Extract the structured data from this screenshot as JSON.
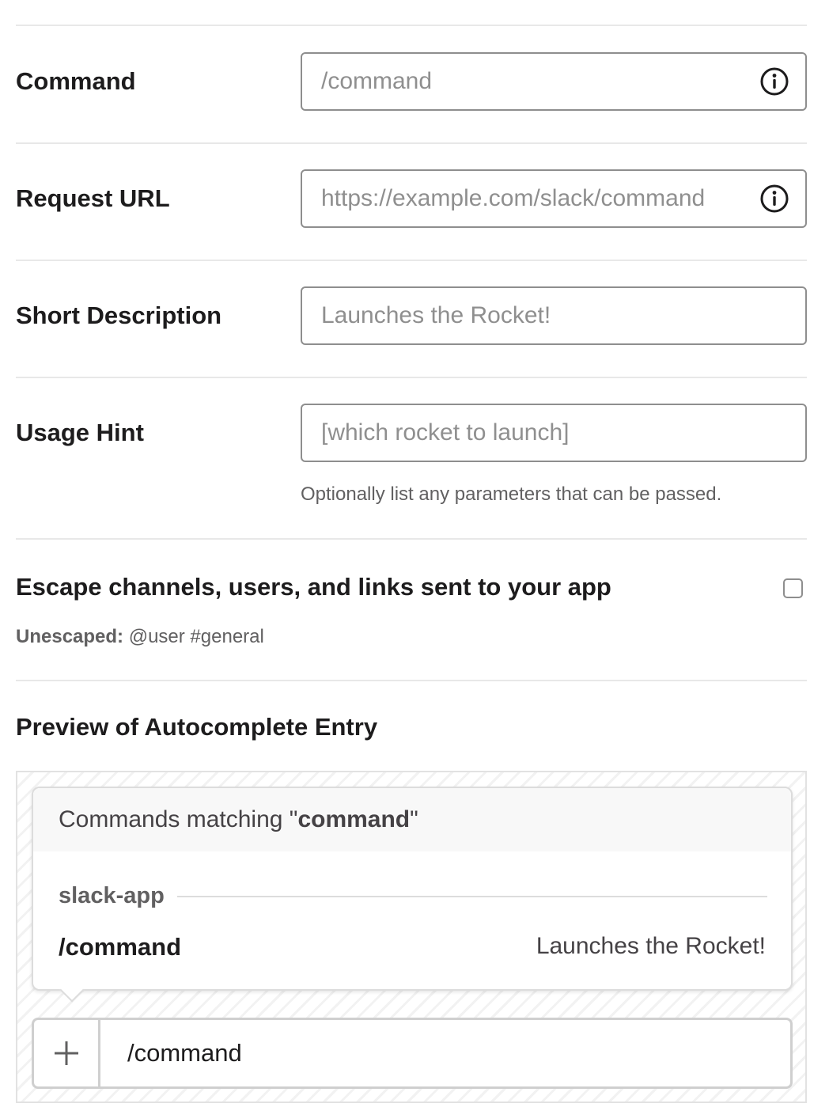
{
  "fields": [
    {
      "label": "Command",
      "placeholder": "/command",
      "value": "",
      "has_info_icon": true
    },
    {
      "label": "Request URL",
      "placeholder": "https://example.com/slack/command",
      "value": "",
      "has_info_icon": true
    },
    {
      "label": "Short Description",
      "placeholder": "Launches the Rocket!",
      "value": "",
      "has_info_icon": false
    },
    {
      "label": "Usage Hint",
      "placeholder": "[which rocket to launch]",
      "value": "",
      "has_info_icon": false,
      "hint": "Optionally list any parameters that can be passed."
    }
  ],
  "escape": {
    "label": "Escape channels, users, and links sent to your app",
    "checked": false,
    "unescaped_label": "Unescaped:",
    "unescaped_example": " @user #general"
  },
  "preview": {
    "title": "Preview of Autocomplete Entry",
    "header_prefix": "Commands matching \"",
    "header_term": "command",
    "header_suffix": "\"",
    "app_name": "slack-app",
    "command": "/command",
    "description": "Launches the Rocket!",
    "message_input": "/command",
    "plus_icon": "plus-icon"
  },
  "icons": {
    "info": "info-circle-icon"
  },
  "colors": {
    "border": "#8e8e8e",
    "placeholder": "#8f8f8f",
    "text": "#1d1c1d",
    "muted": "#616061"
  }
}
